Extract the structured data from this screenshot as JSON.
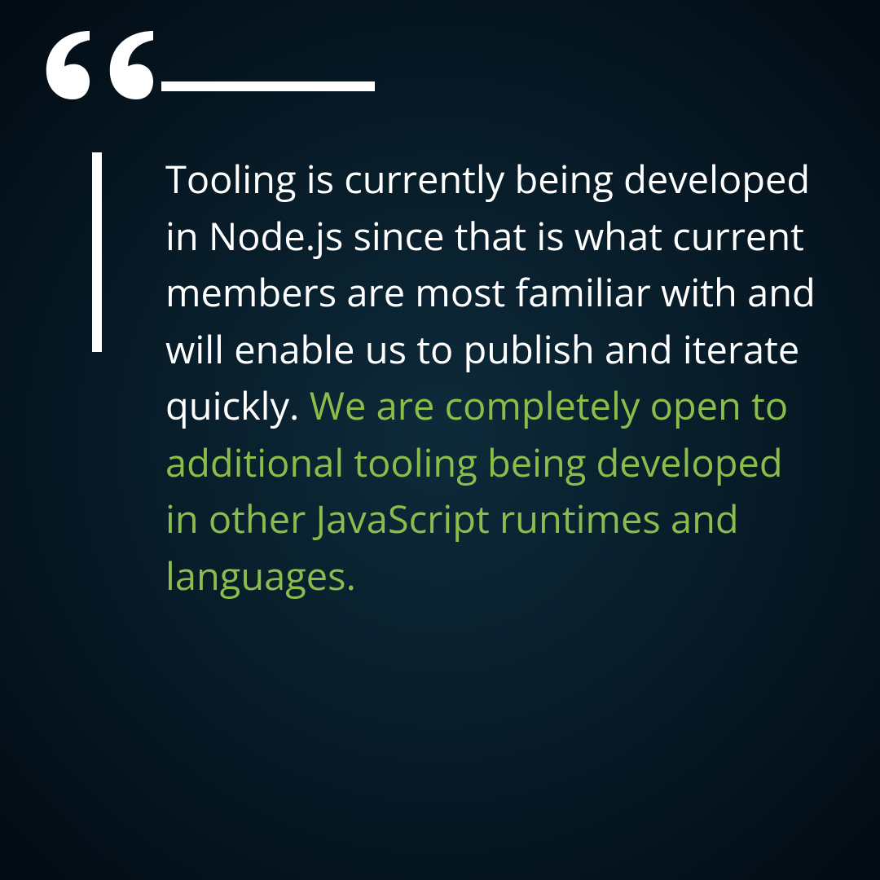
{
  "quote": {
    "primary_text": "Tooling is currently being developed in Node.js since that is what current members are most familiar with and will enable us to publish and iterate quickly.",
    "accent_text": "We are completely open to additional tooling being developed in other JavaScript runtimes and languages."
  },
  "colors": {
    "background_center": "#0e2a3a",
    "background_edge": "#020a12",
    "text_primary": "#ffffff",
    "text_accent": "#8bbd4a"
  }
}
